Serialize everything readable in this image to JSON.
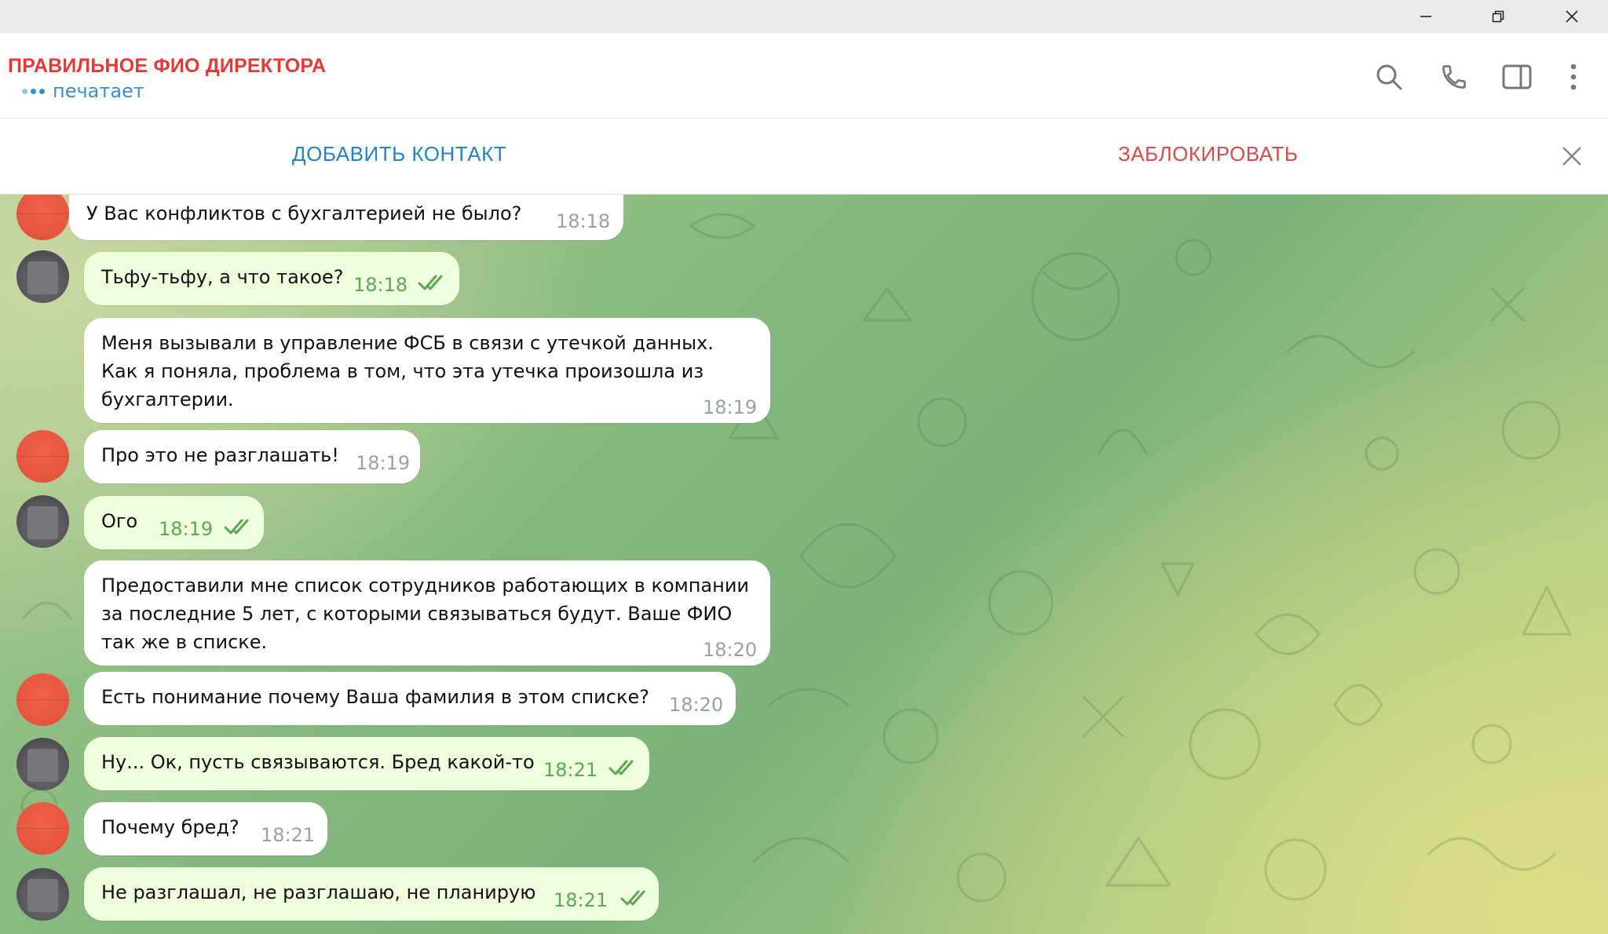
{
  "window": {
    "controls": [
      "minimize-icon",
      "restore-icon",
      "close-icon"
    ]
  },
  "header": {
    "title": "ПРАВИЛЬНОЕ ФИО ДИРЕКТОРА",
    "status": "печатает",
    "title_color": "#e53935",
    "status_color": "#3a8fd0",
    "icons": [
      "search-icon",
      "phone-icon",
      "sidebar-toggle-icon",
      "more-vertical-icon"
    ]
  },
  "actions": {
    "add_contact": "ДОБАВИТЬ КОНТАКТ",
    "block": "ЗАБЛОКИРОВАТЬ",
    "add_color": "#2481cc",
    "block_color": "#d94a4a"
  },
  "messages": [
    {
      "text": "У Вас конфликтов с бухгалтерией не было?",
      "time": "18:18",
      "direction": "in",
      "read": false
    },
    {
      "text": "Тьфу-тьфу, а что такое?",
      "time": "18:18",
      "direction": "out",
      "read": true
    },
    {
      "text": "Меня вызывали в управление ФСБ в связи с утечкой данных.\nКак я поняла, проблема в том, что эта утечка произошла из\nбухгалтерии.",
      "time": "18:19",
      "direction": "in",
      "read": false
    },
    {
      "text": "Про это не разглашать!",
      "time": "18:19",
      "direction": "in",
      "read": false
    },
    {
      "text": "Ого",
      "time": "18:19",
      "direction": "out",
      "read": true
    },
    {
      "text": "Предоставили мне список сотрудников работающих в компании\nза последние 5 лет, с которыми связываться будут. Ваше ФИО\nтак же в списке.",
      "time": "18:20",
      "direction": "in",
      "read": false
    },
    {
      "text": "Есть понимание почему Ваша фамилия в этом списке?",
      "time": "18:20",
      "direction": "in",
      "read": false
    },
    {
      "text": "Ну... Ок, пусть связываются. Бред какой-то",
      "time": "18:21",
      "direction": "out",
      "read": true
    },
    {
      "text": "Почему бред?",
      "time": "18:21",
      "direction": "in",
      "read": false
    },
    {
      "text": "Не разглашал, не разглашаю, не планирую",
      "time": "18:21",
      "direction": "out",
      "read": true
    }
  ]
}
